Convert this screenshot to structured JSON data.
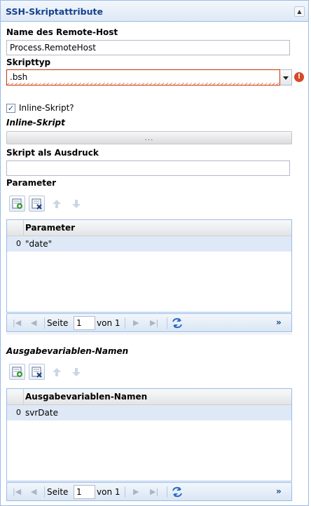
{
  "panel": {
    "title": "SSH-Skriptattribute"
  },
  "remote_host": {
    "label": "Name des Remote-Host",
    "value": "Process.RemoteHost"
  },
  "script_type": {
    "label": "Skripttyp",
    "value": ".bsh"
  },
  "inline_checkbox": {
    "label": "Inline-Skript?",
    "checked": true
  },
  "inline_script": {
    "label": "Inline-Skript",
    "button_text": "..."
  },
  "script_expression": {
    "label": "Skript als Ausdruck",
    "value": ""
  },
  "parameters": {
    "label": "Parameter",
    "toolbar_icons": [
      "add-row-icon",
      "delete-row-icon",
      "move-up-icon",
      "move-down-icon"
    ],
    "grid": {
      "column_header": "Parameter",
      "rows": [
        {
          "index": "0",
          "value": "\"date\""
        }
      ]
    },
    "pager": {
      "page_label": "Seite",
      "page_value": "1",
      "of_label": "von 1",
      "more": "»"
    }
  },
  "output_vars": {
    "label": "Ausgabevariablen-Namen",
    "toolbar_icons": [
      "add-row-icon",
      "delete-row-icon",
      "move-up-icon",
      "move-down-icon"
    ],
    "grid": {
      "column_header": "Ausgabevariablen-Namen",
      "rows": [
        {
          "index": "0",
          "value": "svrDate"
        }
      ]
    },
    "pager": {
      "page_label": "Seite",
      "page_value": "1",
      "of_label": "von 1",
      "more": "»"
    }
  },
  "colors": {
    "header_text": "#15428b",
    "border": "#99bbe8",
    "error": "#cc3300",
    "selected_row": "#dfe8f6"
  }
}
